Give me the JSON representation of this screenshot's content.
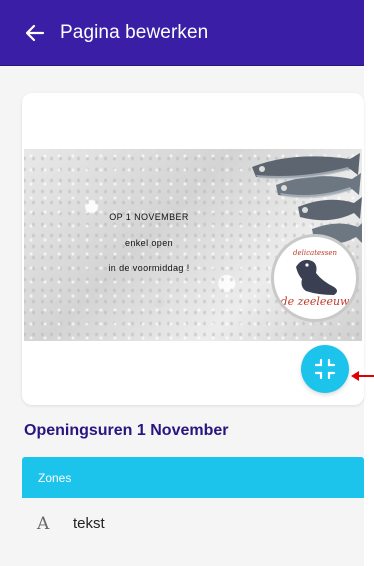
{
  "appbar": {
    "title": "Pagina bewerken",
    "back_icon": "arrow-left-icon",
    "color": "#3a1fa6"
  },
  "poster": {
    "line1": "OP 1 NOVEMBER",
    "line2": "enkel open",
    "line3": "in de voormiddag !",
    "logo_small": "delicatessen",
    "logo_brand": "de zeeleeuw"
  },
  "fab": {
    "icon": "fullscreen-exit-icon",
    "color": "#1cc4ec"
  },
  "section": {
    "title": "Openingsuren 1 November"
  },
  "zones": {
    "header": "Zones",
    "items": [
      {
        "icon": "text-icon",
        "glyph": "A",
        "label": "tekst"
      }
    ]
  }
}
